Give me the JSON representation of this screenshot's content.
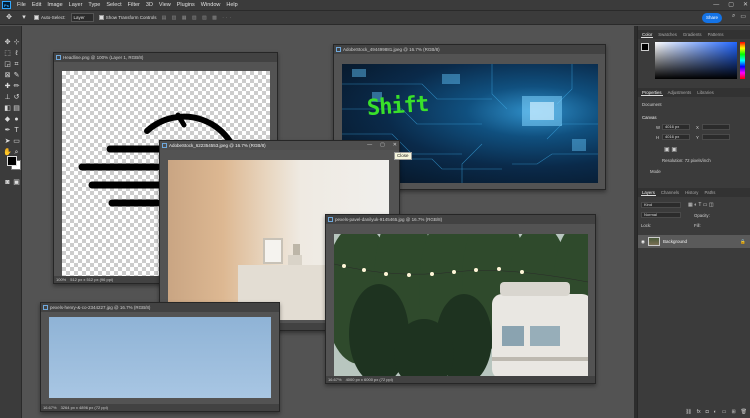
{
  "app": {
    "logo": "Ps"
  },
  "menubar": {
    "items": [
      "File",
      "Edit",
      "Image",
      "Layer",
      "Type",
      "Select",
      "Filter",
      "3D",
      "View",
      "Plugins",
      "Window",
      "Help"
    ],
    "window_controls": [
      "—",
      "▢",
      "✕"
    ]
  },
  "options_bar": {
    "auto_select_label": "Auto-Select:",
    "auto_select_value": "Layer",
    "show_transform_label": "Show Transform Controls",
    "share_label": "Share"
  },
  "documents": {
    "headline": {
      "title": "Headline.png @ 100% (Layer 1, RGB/8)",
      "status_zoom": "100%",
      "status_info": "512 px x 512 px (96 ppi)"
    },
    "adobestock_circuit": {
      "title": "AdobeStock_494499881.jpeg @ 16.7% (RGB/8)",
      "overlay_text": "Shift"
    },
    "adobestock_room": {
      "title": "AdobeStock_622354553.jpeg @ 16.7% (RGB/8)",
      "status_zoom": "16.67%",
      "status_info": "6464 px x 4512 px (300 ppi)",
      "tooltip": "Close"
    },
    "pexels_pavel": {
      "title": "pexels-pavel-danilyuk-9145465.jpg @ 16.7% (RGB/8)",
      "status_zoom": "16.67%",
      "status_info": "4000 px x 6000 px (72 ppi)"
    },
    "pexels_henry": {
      "title": "pexels-henry-&-co-2344227.jpg @ 16.7% (RGB/8)",
      "status_zoom": "16.67%",
      "status_info": "3264 px x 4896 px (72 ppi)"
    }
  },
  "panels": {
    "color_tabs": [
      "Color",
      "Swatches",
      "Gradients",
      "Patterns"
    ],
    "properties_tabs": [
      "Properties",
      "Adjustments",
      "Libraries"
    ],
    "properties_doc_label": "Document",
    "canvas_label": "Canvas",
    "width_label": "W",
    "width_value": "4016 px",
    "height_label": "H",
    "height_value": "4016 px",
    "x_label": "X",
    "y_label": "Y",
    "resolution_label": "Resolution: 72 pixels/inch",
    "mode_label": "Mode",
    "layers_tabs": [
      "Layers",
      "Channels",
      "History",
      "Paths"
    ],
    "layers_kind_placeholder": "Kind",
    "layers_blend_mode": "Normal",
    "layers_opacity_label": "Opacity:",
    "layers_lock_label": "Lock:",
    "layers_fill_label": "Fill:",
    "layer_name": "Background",
    "colors": {
      "accent": "#1473e6",
      "shift_text": "#39e02a",
      "panel_bg": "#3b3b3b"
    }
  }
}
